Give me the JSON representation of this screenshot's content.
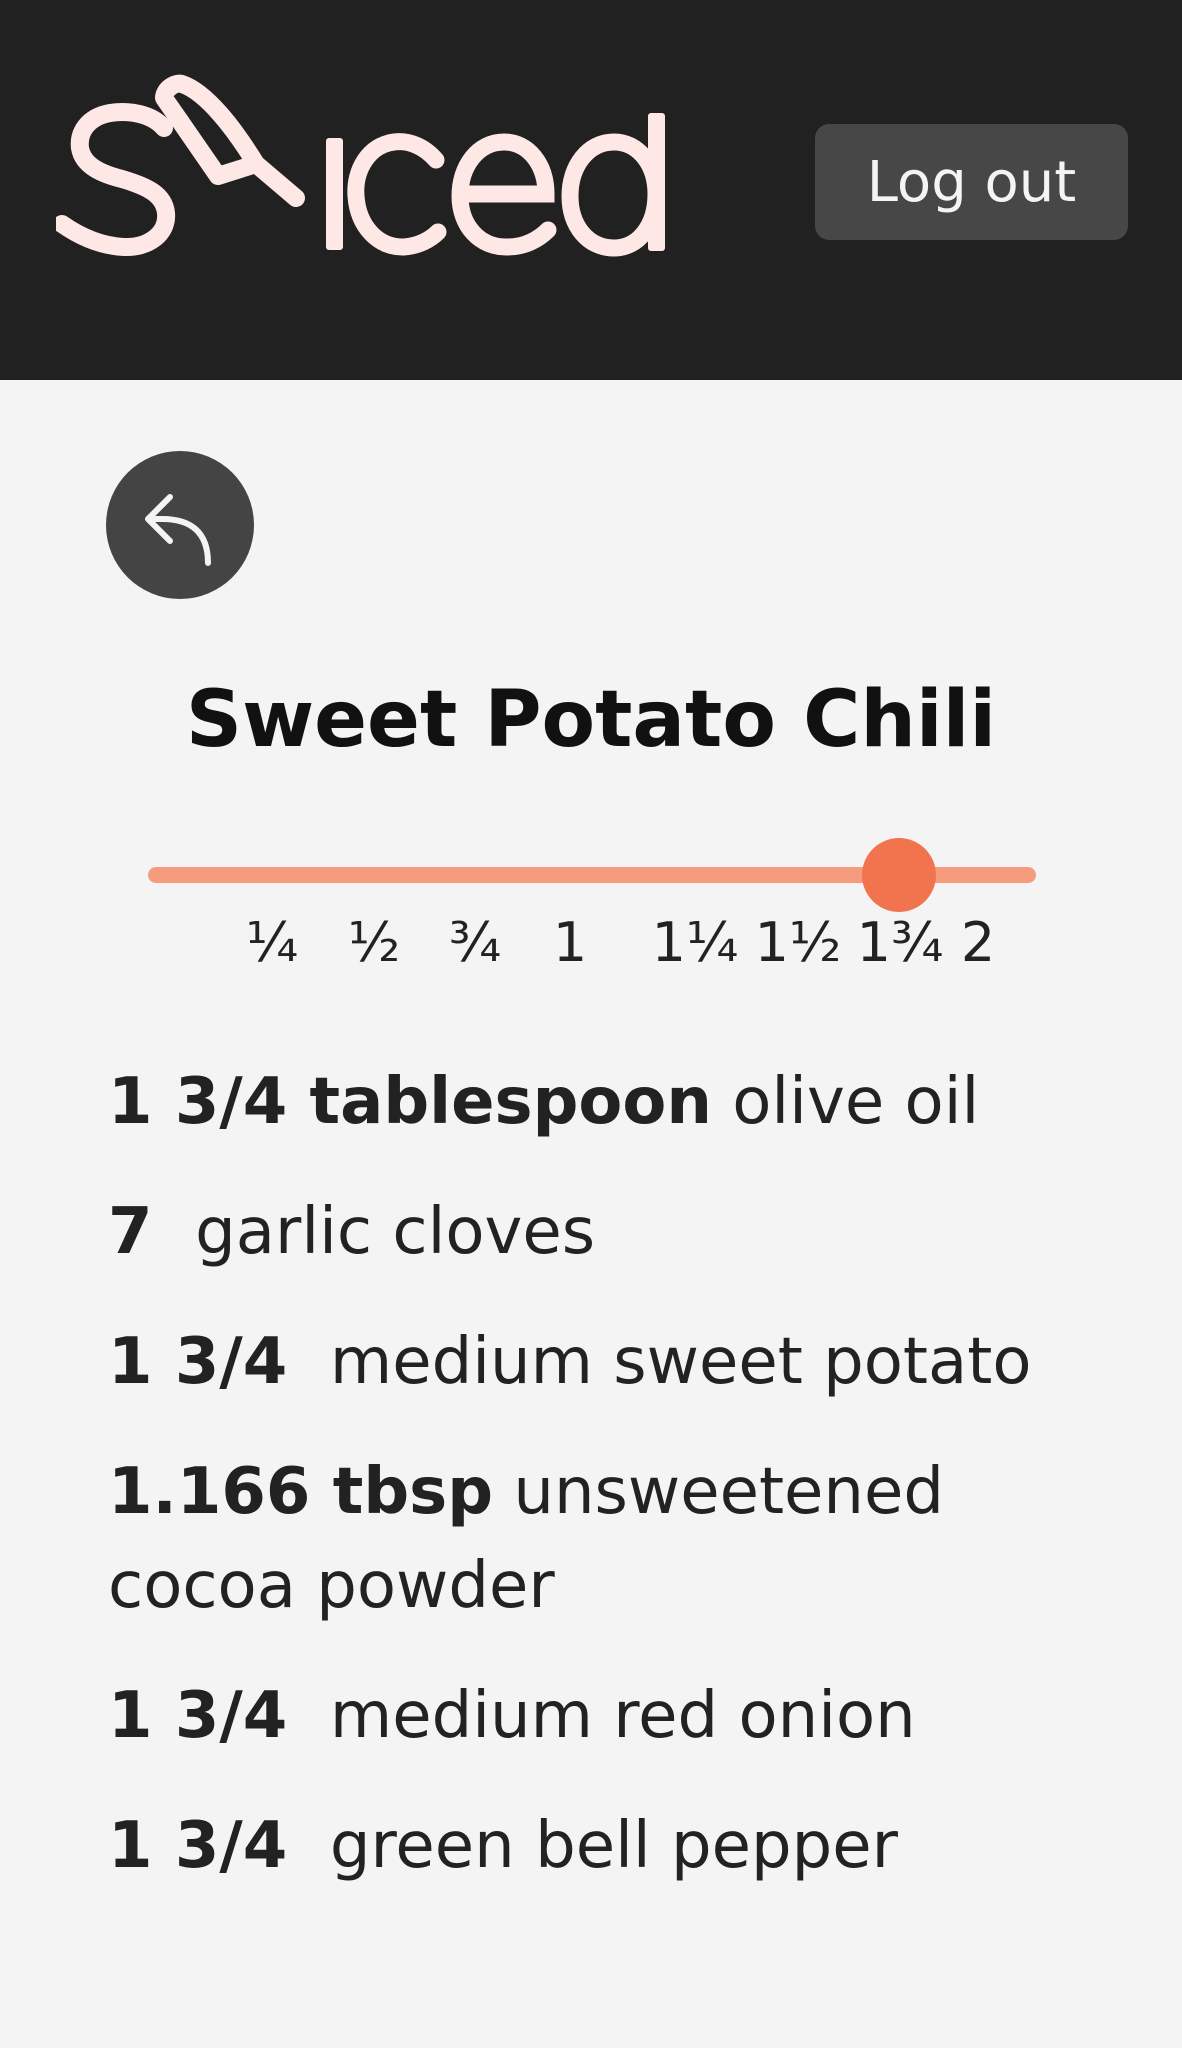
{
  "header": {
    "logo_text": "Sliced",
    "logout_label": "Log out"
  },
  "recipe": {
    "title": "Sweet Potato Chili"
  },
  "scale_slider": {
    "ticks": [
      "¼",
      "½",
      "¾",
      "1",
      "1¼",
      "1½",
      "1¾",
      "2"
    ],
    "selected": "1¾",
    "value": 1.75
  },
  "ingredients": [
    {
      "amount": "1 3/4 tablespoon",
      "name": "olive oil"
    },
    {
      "amount": "7 ",
      "name": "garlic cloves"
    },
    {
      "amount": "1 3/4 ",
      "name": "medium sweet potato"
    },
    {
      "amount": "1.166 tbsp",
      "name": "unsweetened cocoa powder"
    },
    {
      "amount": "1 3/4 ",
      "name": "medium red onion"
    },
    {
      "amount": "1 3/4 ",
      "name": "green bell pepper"
    }
  ],
  "colors": {
    "header_bg": "#212121",
    "logo": "#fde8e5",
    "slider_track": "#f79b7f",
    "slider_thumb": "#f2744f",
    "page_bg": "#f4f4f4"
  },
  "icons": {
    "back": "reply-arrow-icon",
    "logo_mark": "knife-icon"
  }
}
